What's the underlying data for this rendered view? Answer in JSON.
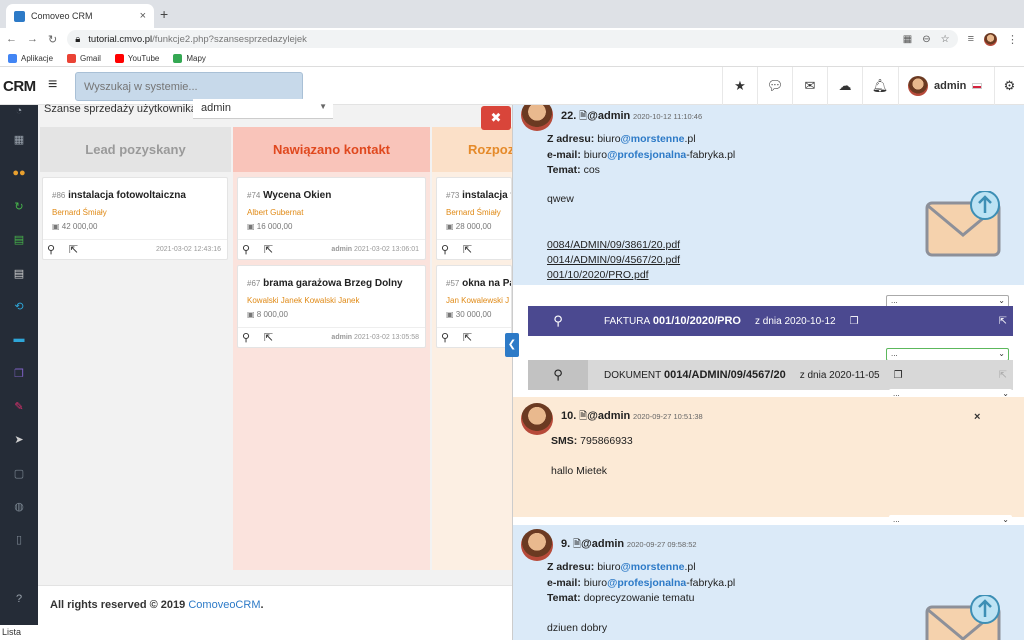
{
  "browser": {
    "tab_title": "Comoveo CRM",
    "url_host": "tutorial.cmvo.pl",
    "url_path": "/funkcje2.php?szansesprzedazylejek",
    "bookmarks": [
      {
        "label": "Aplikacje",
        "color": "#4285f4"
      },
      {
        "label": "Gmail",
        "color": "#ea4335"
      },
      {
        "label": "YouTube",
        "color": "#ff0000"
      },
      {
        "label": "Mapy",
        "color": "#34a853"
      }
    ]
  },
  "header": {
    "logo": "CRM",
    "search_placeholder": "Wyszukaj w systemie...",
    "user_name": "admin"
  },
  "filter": {
    "label": "Szanse sprzedaży użytkownika:",
    "value": "admin"
  },
  "columns": [
    {
      "title": "Lead pozyskany",
      "color": "#9a9a9a",
      "bg": "#e4e4e4"
    },
    {
      "title": "Nawiązano kontakt",
      "color": "#e0481e",
      "bg": "#f9c4ba"
    },
    {
      "title": "Rozpoz",
      "color": "#e58a2a",
      "bg": "#fbe0c8"
    }
  ],
  "cards": [
    {
      "no": "#86",
      "title": "instalacja fotowoltaiczna",
      "people": "Bernard Śmiały",
      "value": "42 000,00",
      "date": "2021-03-02 12:43:16",
      "owner": ""
    },
    {
      "no": "#74",
      "title": "Wycena Okien",
      "people": "Albert Gubernat",
      "value": "16 000,00",
      "date": "2021-03-02 13:06:01",
      "owner": "admin"
    },
    {
      "no": "#67",
      "title": "brama garażowa Brzeg Dolny",
      "people": "Kowalski Janek Kowalski Janek",
      "value": "8 000,00",
      "date": "2021-03-02 13:05:58",
      "owner": "admin"
    },
    {
      "no": "#73",
      "title": "instalacja fo",
      "people": "Bernard Śmiały",
      "value": "28 000,00",
      "date": "",
      "owner": ""
    },
    {
      "no": "#57",
      "title": "okna na Pa",
      "people": "Jan Kowalewski J",
      "value": "30 000,00",
      "date": "",
      "owner": ""
    }
  ],
  "footer": {
    "text": "All rights reserved © 2019",
    "link": "ComoveoCRM",
    "dot": "."
  },
  "status_text": "Lista",
  "notes": [
    {
      "num": "22.",
      "user": "@admin",
      "ts": "2020-10-12 11:10:46",
      "from_label": "Z adresu:",
      "from_pre": "biuro",
      "from_hl": "@morstenne",
      "from_post": ".pl",
      "email_label": "e-mail:",
      "email_pre": "biuro",
      "email_hl": "@profesjonalna",
      "email_post": "-fabryka.pl",
      "subject_label": "Temat:",
      "subject": "cos",
      "body": "qwew",
      "files": [
        "0084/ADMIN/09/3861/20.pdf",
        "0014/ADMIN/09/4567/20.pdf",
        "001/10/2020/PRO.pdf"
      ]
    },
    {
      "num": "10.",
      "user": "@admin",
      "ts": "2020-09-27 10:51:38",
      "sms_label": "SMS:",
      "sms": "795866933",
      "body": "hallo Mietek"
    },
    {
      "num": "9.",
      "user": "@admin",
      "ts": "2020-09-27 09:58:52",
      "from_label": "Z adresu:",
      "from_pre": "biuro",
      "from_hl": "@morstenne",
      "from_post": ".pl",
      "email_label": "e-mail:",
      "email_pre": "biuro",
      "email_hl": "@profesjonalna",
      "email_post": "-fabryka.pl",
      "subject_label": "Temat:",
      "subject": "doprecyzowanie tematu",
      "body": "dziuen dobry"
    }
  ],
  "doc_bars": [
    {
      "type": "FAKTURA",
      "number": "001/10/2020/PRO",
      "date": "z dnia 2020-10-12",
      "bg": "#4b4990",
      "fg": "#ffffff"
    },
    {
      "type": "DOKUMENT",
      "number": "0014/ADMIN/09/4567/20",
      "date": "z dnia 2020-11-05",
      "bg": "#d8d8d8",
      "fg": "#222222"
    }
  ],
  "dropdowns": {
    "value": "..."
  },
  "colors": {
    "accent": "#2d7ac7",
    "sidebar": "#252c37",
    "danger": "#d9453a",
    "email_note": "#dbeaf8",
    "sms_note": "#fcead6"
  }
}
